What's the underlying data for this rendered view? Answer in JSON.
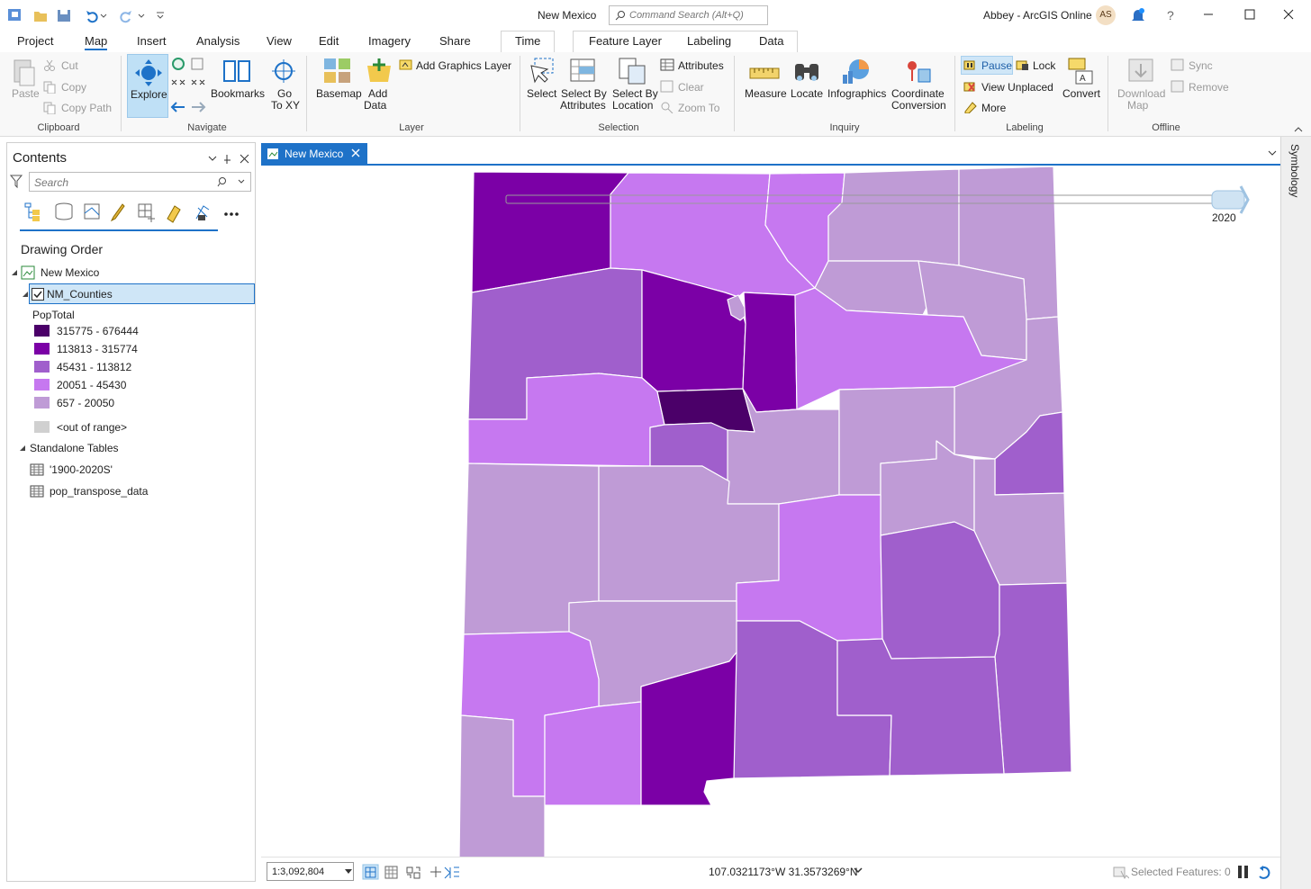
{
  "app": {
    "title": "New Mexico",
    "search_placeholder": "Command Search (Alt+Q)",
    "user": "Abbey - ArcGIS Online",
    "user_initials": "AS"
  },
  "tabs": [
    "Project",
    "Map",
    "Insert",
    "Analysis",
    "View",
    "Edit",
    "Imagery",
    "Share",
    "Time",
    "Feature Layer",
    "Labeling",
    "Data"
  ],
  "ribbon": {
    "clipboard": {
      "paste": "Paste",
      "cut": "Cut",
      "copy": "Copy",
      "copy_path": "Copy Path",
      "label": "Clipboard"
    },
    "navigate": {
      "explore": "Explore",
      "bookmarks": "Bookmarks",
      "goto": "Go",
      "goto2": "To XY",
      "label": "Navigate"
    },
    "layer": {
      "basemap": "Basemap",
      "add_data": "Add",
      "add_data2": "Data",
      "add_graphics": "Add Graphics Layer",
      "label": "Layer"
    },
    "selection": {
      "select": "Select",
      "sba1": "Select By",
      "sba2": "Attributes",
      "sbl1": "Select By",
      "sbl2": "Location",
      "attributes": "Attributes",
      "clear": "Clear",
      "zoom_to": "Zoom To",
      "label": "Selection"
    },
    "inquiry": {
      "measure": "Measure",
      "locate": "Locate",
      "infographics": "Infographics",
      "coord1": "Coordinate",
      "coord2": "Conversion",
      "label": "Inquiry"
    },
    "labeling": {
      "pause": "Pause",
      "lock": "Lock",
      "view_unplaced": "View Unplaced",
      "more": "More",
      "convert": "Convert",
      "label": "Labeling"
    },
    "offline": {
      "download1": "Download",
      "download2": "Map",
      "sync": "Sync",
      "remove": "Remove",
      "label": "Offline"
    }
  },
  "contents": {
    "title": "Contents",
    "search_placeholder": "Search",
    "drawing_order": "Drawing Order",
    "map_name": "New Mexico",
    "layer_name": "NM_Counties",
    "field": "PopTotal",
    "legend": [
      {
        "label": "315775 - 676444",
        "color": "#4b0069"
      },
      {
        "label": "113813 - 315774",
        "color": "#7b00a6"
      },
      {
        "label": "45431 - 113812",
        "color": "#a05fcc"
      },
      {
        "label": "20051 - 45430",
        "color": "#c678f0"
      },
      {
        "label": "657 - 20050",
        "color": "#bf9bd6"
      }
    ],
    "out_of_range": "<out of range>",
    "out_of_range_color": "#d0d0d0",
    "standalone": "Standalone Tables",
    "tables": [
      "'1900-2020S'",
      "pop_transpose_data"
    ]
  },
  "map": {
    "tab_label": "New Mexico",
    "time_label": "2020"
  },
  "status": {
    "scale": "1:3,092,804",
    "coords": "107.0321173°W 31.3573269°N",
    "selected": "Selected Features: 0"
  },
  "side_pane": "Symbology",
  "colors": {
    "c1": "#4b0069",
    "c2": "#7b00a6",
    "c3": "#a05fcc",
    "c4": "#c678f0",
    "c5": "#bf9bd6",
    "accent": "#1e72c8"
  }
}
